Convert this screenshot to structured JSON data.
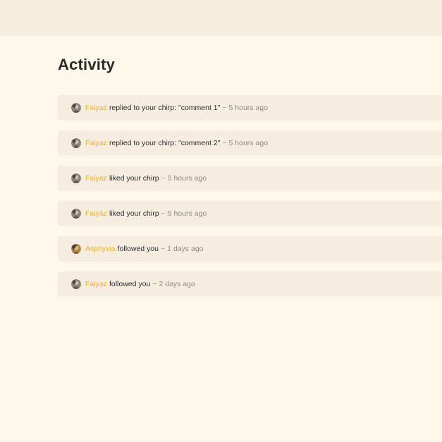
{
  "page": {
    "title": "Activity"
  },
  "separator": "~",
  "colors": {
    "background": "#fef8ea",
    "topbar": "#f5eedf",
    "card": "#f5eee0",
    "accent": "#e8b427"
  },
  "activities": [
    {
      "user": "Faiyaz",
      "action": "replied to your chirp: \"comment 1\"",
      "time": "5 hours ago",
      "avatar": "faiyaz-avatar"
    },
    {
      "user": "Faiyaz",
      "action": "replied to your chirp: \"comment 2\"",
      "time": "5 hours ago",
      "avatar": "faiyaz-avatar"
    },
    {
      "user": "Faiyaz",
      "action": "liked your chirp",
      "time": "5 hours ago",
      "avatar": "faiyaz-avatar"
    },
    {
      "user": "Faiyaz",
      "action": "liked your chirp",
      "time": "5 hours ago",
      "avatar": "faiyaz-avatar"
    },
    {
      "user": "Asphyxia",
      "action": "followed you",
      "time": "1 days ago",
      "avatar": "asphyxia-avatar"
    },
    {
      "user": "Faiyaz",
      "action": "followed you",
      "time": "2 days ago",
      "avatar": "faiyaz-avatar"
    }
  ]
}
